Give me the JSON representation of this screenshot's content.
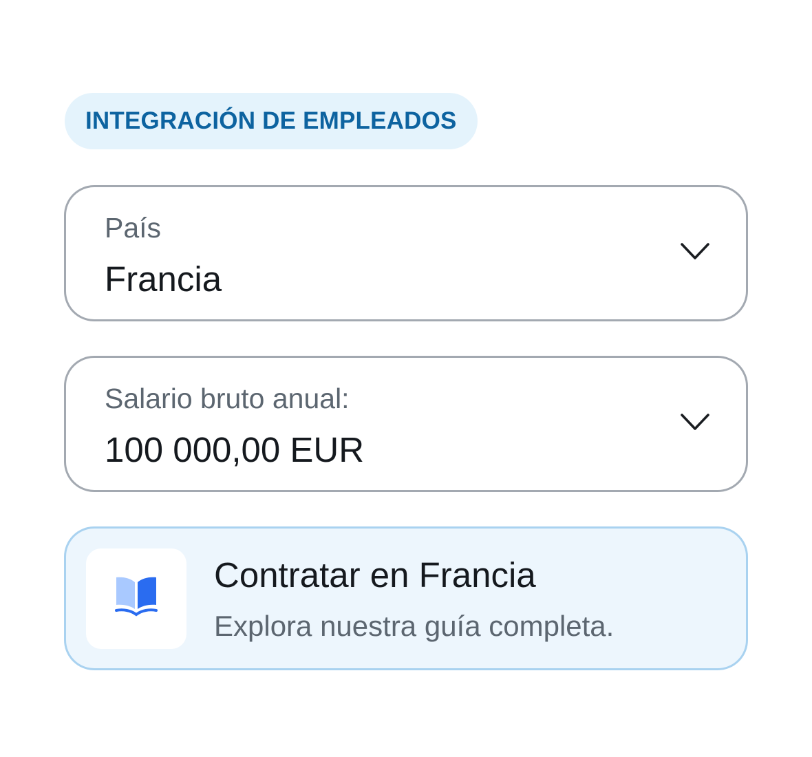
{
  "badge": {
    "label": "INTEGRACIÓN DE EMPLEADOS"
  },
  "country_select": {
    "label": "País",
    "value": "Francia",
    "icon": "chevron-down-icon"
  },
  "salary_select": {
    "label": "Salario bruto anual:",
    "value": "100 000,00 EUR",
    "icon": "chevron-down-icon"
  },
  "guide_card": {
    "title": "Contratar en Francia",
    "subtitle": "Explora nuestra guía completa.",
    "icon": "book-icon"
  },
  "colors": {
    "badge_bg": "#e4f3fc",
    "badge_text": "#0d63a0",
    "field_border": "#a3a9b1",
    "card_bg": "#edf6fd",
    "card_border": "#a9d2f0",
    "book_blue": "#2a6cf0",
    "book_light": "#a9c9ff"
  }
}
